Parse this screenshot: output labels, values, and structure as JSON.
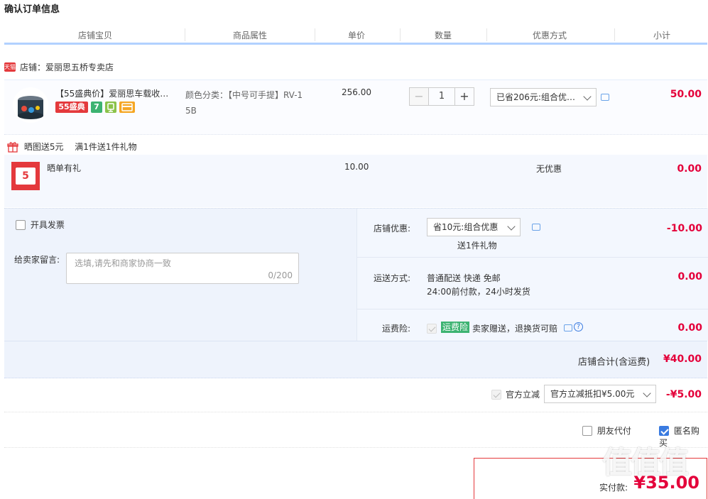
{
  "title": "确认订单信息",
  "columns": [
    "店铺宝贝",
    "商品属性",
    "单价",
    "数量",
    "优惠方式",
    "小计"
  ],
  "shop": {
    "badge": "天猫",
    "label": "店铺：爱丽思五桥专卖店"
  },
  "item": {
    "name": "【55盛典价】爱丽思车载收纳…",
    "tag_55": "55盛典",
    "tag_7": "7",
    "prop_line1": "颜色分类：【中号可手提】RV-1",
    "prop_line2": "5B",
    "price": "256.00",
    "qty_minus": "−",
    "qty": "1",
    "qty_plus": "+",
    "discount": "已省206元:组合优…",
    "subtotal": "50.00"
  },
  "gift": {
    "promo1": "晒图送5元",
    "promo2": "满1件送1件礼物",
    "name": "晒单有礼",
    "thumb_text": "5",
    "price": "10.00",
    "discount": "无优惠",
    "subtotal": "0.00"
  },
  "form": {
    "invoice_label": "开具发票",
    "message_label": "给卖家留言:",
    "message_placeholder": "选填,请先和商家协商一致",
    "message_counter": "0/200"
  },
  "shop_discount": {
    "label": "店铺优惠:",
    "value": "省10元:组合优惠",
    "gift_note": "送1件礼物",
    "amount": "-10.00"
  },
  "shipping": {
    "label": "运送方式:",
    "line1": "普通配送 快递 免邮",
    "line2": "24:00前付款，24小时发货",
    "amount": "0.00"
  },
  "insurance": {
    "label": "运费险:",
    "badge": "运费险",
    "text": "卖家赠送，退换货可赔",
    "help": "?",
    "amount": "0.00"
  },
  "shop_total": {
    "label": "店铺合计(含运费)",
    "amount": "¥40.00"
  },
  "gov": {
    "label": "官方立减",
    "select": "官方立减抵扣¥5.00元",
    "amount": "-¥5.00"
  },
  "pay_options": {
    "friend": "朋友代付",
    "anonymous": "匿名购买"
  },
  "final": {
    "label": "实付款:",
    "amount": "¥35.00"
  },
  "watermark": "值值值",
  "colors": {
    "accent_red": "#e4003a",
    "header_line": "#b2d1ff",
    "tag_green": "#3cb371",
    "checkbox_blue": "#3a7be0"
  }
}
